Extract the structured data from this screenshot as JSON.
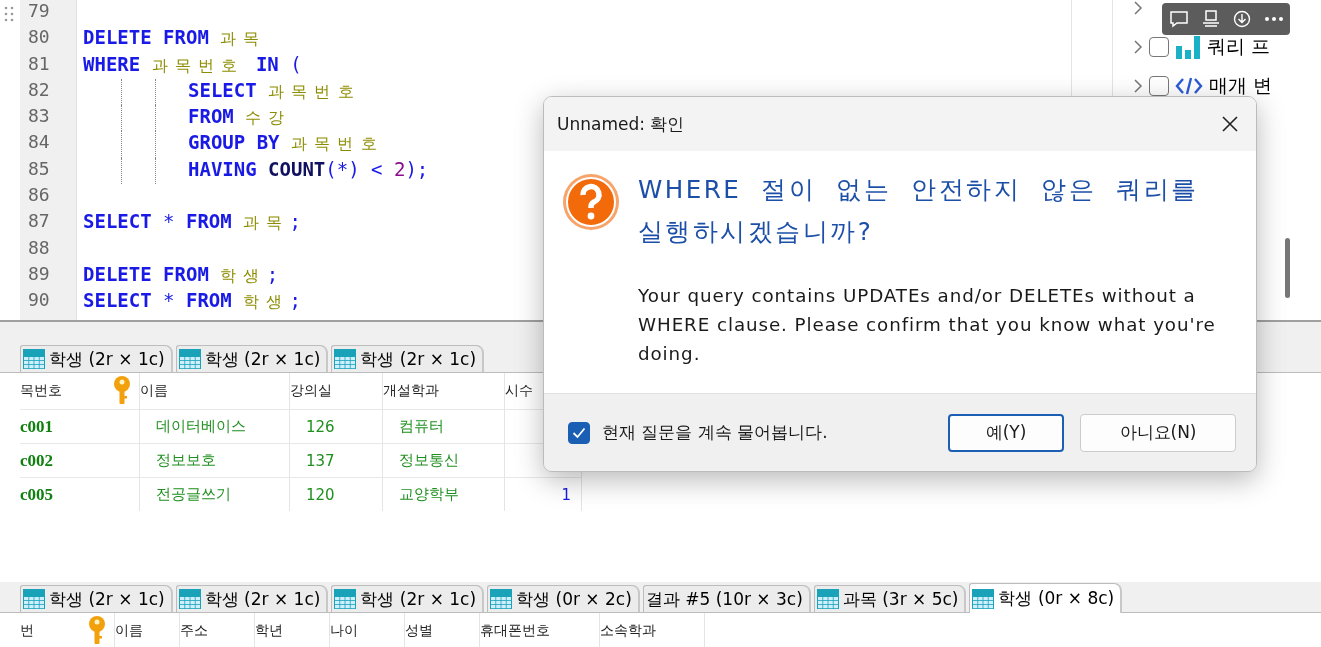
{
  "editor": {
    "lines": [
      {
        "number": "79",
        "indented": false
      },
      {
        "number": "80",
        "indented": false,
        "tokens": [
          {
            "kind": "keyword",
            "text": "DELETE FROM "
          },
          {
            "kind": "ident",
            "text": "과목"
          }
        ]
      },
      {
        "number": "81",
        "indented": false,
        "tokens": [
          {
            "kind": "keyword",
            "text": "WHERE "
          },
          {
            "kind": "ident",
            "text": "과목번호"
          },
          {
            "kind": "keyword",
            "text": " IN "
          },
          {
            "kind": "op",
            "text": "("
          }
        ]
      },
      {
        "number": "82",
        "indented": true,
        "tokens": [
          {
            "kind": "keyword",
            "text": "SELECT "
          },
          {
            "kind": "ident",
            "text": "과목번호"
          }
        ]
      },
      {
        "number": "83",
        "indented": true,
        "tokens": [
          {
            "kind": "keyword",
            "text": "FROM "
          },
          {
            "kind": "ident",
            "text": "수강"
          }
        ]
      },
      {
        "number": "84",
        "indented": true,
        "tokens": [
          {
            "kind": "keyword",
            "text": "GROUP BY "
          },
          {
            "kind": "ident",
            "text": "과목번호"
          }
        ]
      },
      {
        "number": "85",
        "indented": true,
        "tokens": [
          {
            "kind": "keyword",
            "text": "HAVING "
          },
          {
            "kind": "func",
            "text": "COUNT"
          },
          {
            "kind": "op",
            "text": "(*) < "
          },
          {
            "kind": "number",
            "text": "2"
          },
          {
            "kind": "op",
            "text": ");"
          }
        ]
      },
      {
        "number": "86",
        "indented": false
      },
      {
        "number": "87",
        "indented": false,
        "tokens": [
          {
            "kind": "keyword",
            "text": "SELECT "
          },
          {
            "kind": "op",
            "text": "* "
          },
          {
            "kind": "keyword",
            "text": "FROM "
          },
          {
            "kind": "ident",
            "text": "과목"
          },
          {
            "kind": "op",
            "text": ";"
          }
        ]
      },
      {
        "number": "88",
        "indented": false
      },
      {
        "number": "89",
        "indented": false,
        "tokens": [
          {
            "kind": "keyword",
            "text": "DELETE FROM "
          },
          {
            "kind": "ident",
            "text": "학생"
          },
          {
            "kind": "op",
            "text": ";"
          }
        ]
      },
      {
        "number": "90",
        "indented": false,
        "tokens": [
          {
            "kind": "keyword",
            "text": "SELECT "
          },
          {
            "kind": "op",
            "text": "* "
          },
          {
            "kind": "keyword",
            "text": "FROM "
          },
          {
            "kind": "ident",
            "text": "학생"
          },
          {
            "kind": "op",
            "text": ";"
          }
        ]
      }
    ]
  },
  "side_panel": {
    "items": [
      {
        "label": "쿼리 프",
        "checked": false
      },
      {
        "label": "매개 변",
        "checked": false
      }
    ]
  },
  "result_1": {
    "tabs": [
      {
        "label": "학생 (2r × 1c)",
        "kind": "table",
        "selected": false
      },
      {
        "label": "학생 (2r × 1c)",
        "kind": "table",
        "selected": false
      },
      {
        "label": "학생 (2r × 1c)",
        "kind": "table",
        "selected": false
      }
    ],
    "columns": [
      {
        "label": "목번호",
        "kind": "key"
      },
      {
        "label": "이름",
        "kind": "text"
      },
      {
        "label": "강의실",
        "kind": "text"
      },
      {
        "label": "개설학과",
        "kind": "text"
      },
      {
        "label": "시수",
        "kind": "int"
      }
    ],
    "rows": [
      [
        "c001",
        "데이터베이스",
        "126",
        "컴퓨터"
      ],
      [
        "c002",
        "정보보호",
        "137",
        "정보통신"
      ],
      [
        "c005",
        "전공글쓰기",
        "120",
        "교양학부",
        "1"
      ]
    ]
  },
  "result_2": {
    "tabs": [
      {
        "label": "학생 (2r × 1c)",
        "kind": "table",
        "selected": false
      },
      {
        "label": "학생 (2r × 1c)",
        "kind": "table",
        "selected": false
      },
      {
        "label": "학생 (2r × 1c)",
        "kind": "table",
        "selected": false
      },
      {
        "label": "학생 (0r × 2c)",
        "kind": "table",
        "selected": false
      },
      {
        "label": "결과 #5 (10r × 3c)",
        "kind": "result",
        "selected": false
      },
      {
        "label": "과목 (3r × 5c)",
        "kind": "table",
        "selected": false
      },
      {
        "label": "학생 (0r × 8c)",
        "kind": "table",
        "selected": true
      }
    ],
    "columns": [
      {
        "label": "번",
        "kind": "key"
      },
      {
        "label": "이름",
        "kind": "text"
      },
      {
        "label": "주소",
        "kind": "text"
      },
      {
        "label": "학년",
        "kind": "text"
      },
      {
        "label": "나이",
        "kind": "text"
      },
      {
        "label": "성별",
        "kind": "text"
      },
      {
        "label": "휴대폰번호",
        "kind": "text"
      },
      {
        "label": "소속학과",
        "kind": "text"
      }
    ]
  },
  "dialog": {
    "title": "Unnamed: 확인",
    "heading": "WHERE 절이 없는 안전하지 않은 쿼리를 실행하시겠습니까?",
    "message": "Your query contains UPDATEs and/or DELETEs without a WHERE clause. Please confirm that you know what you're doing.",
    "remember": {
      "label": "현재 질문을 계속 물어봅니다.",
      "checked": true
    },
    "buttons": [
      {
        "label": "예(Y)",
        "default": true
      },
      {
        "label": "아니요(N)",
        "default": false
      }
    ]
  }
}
